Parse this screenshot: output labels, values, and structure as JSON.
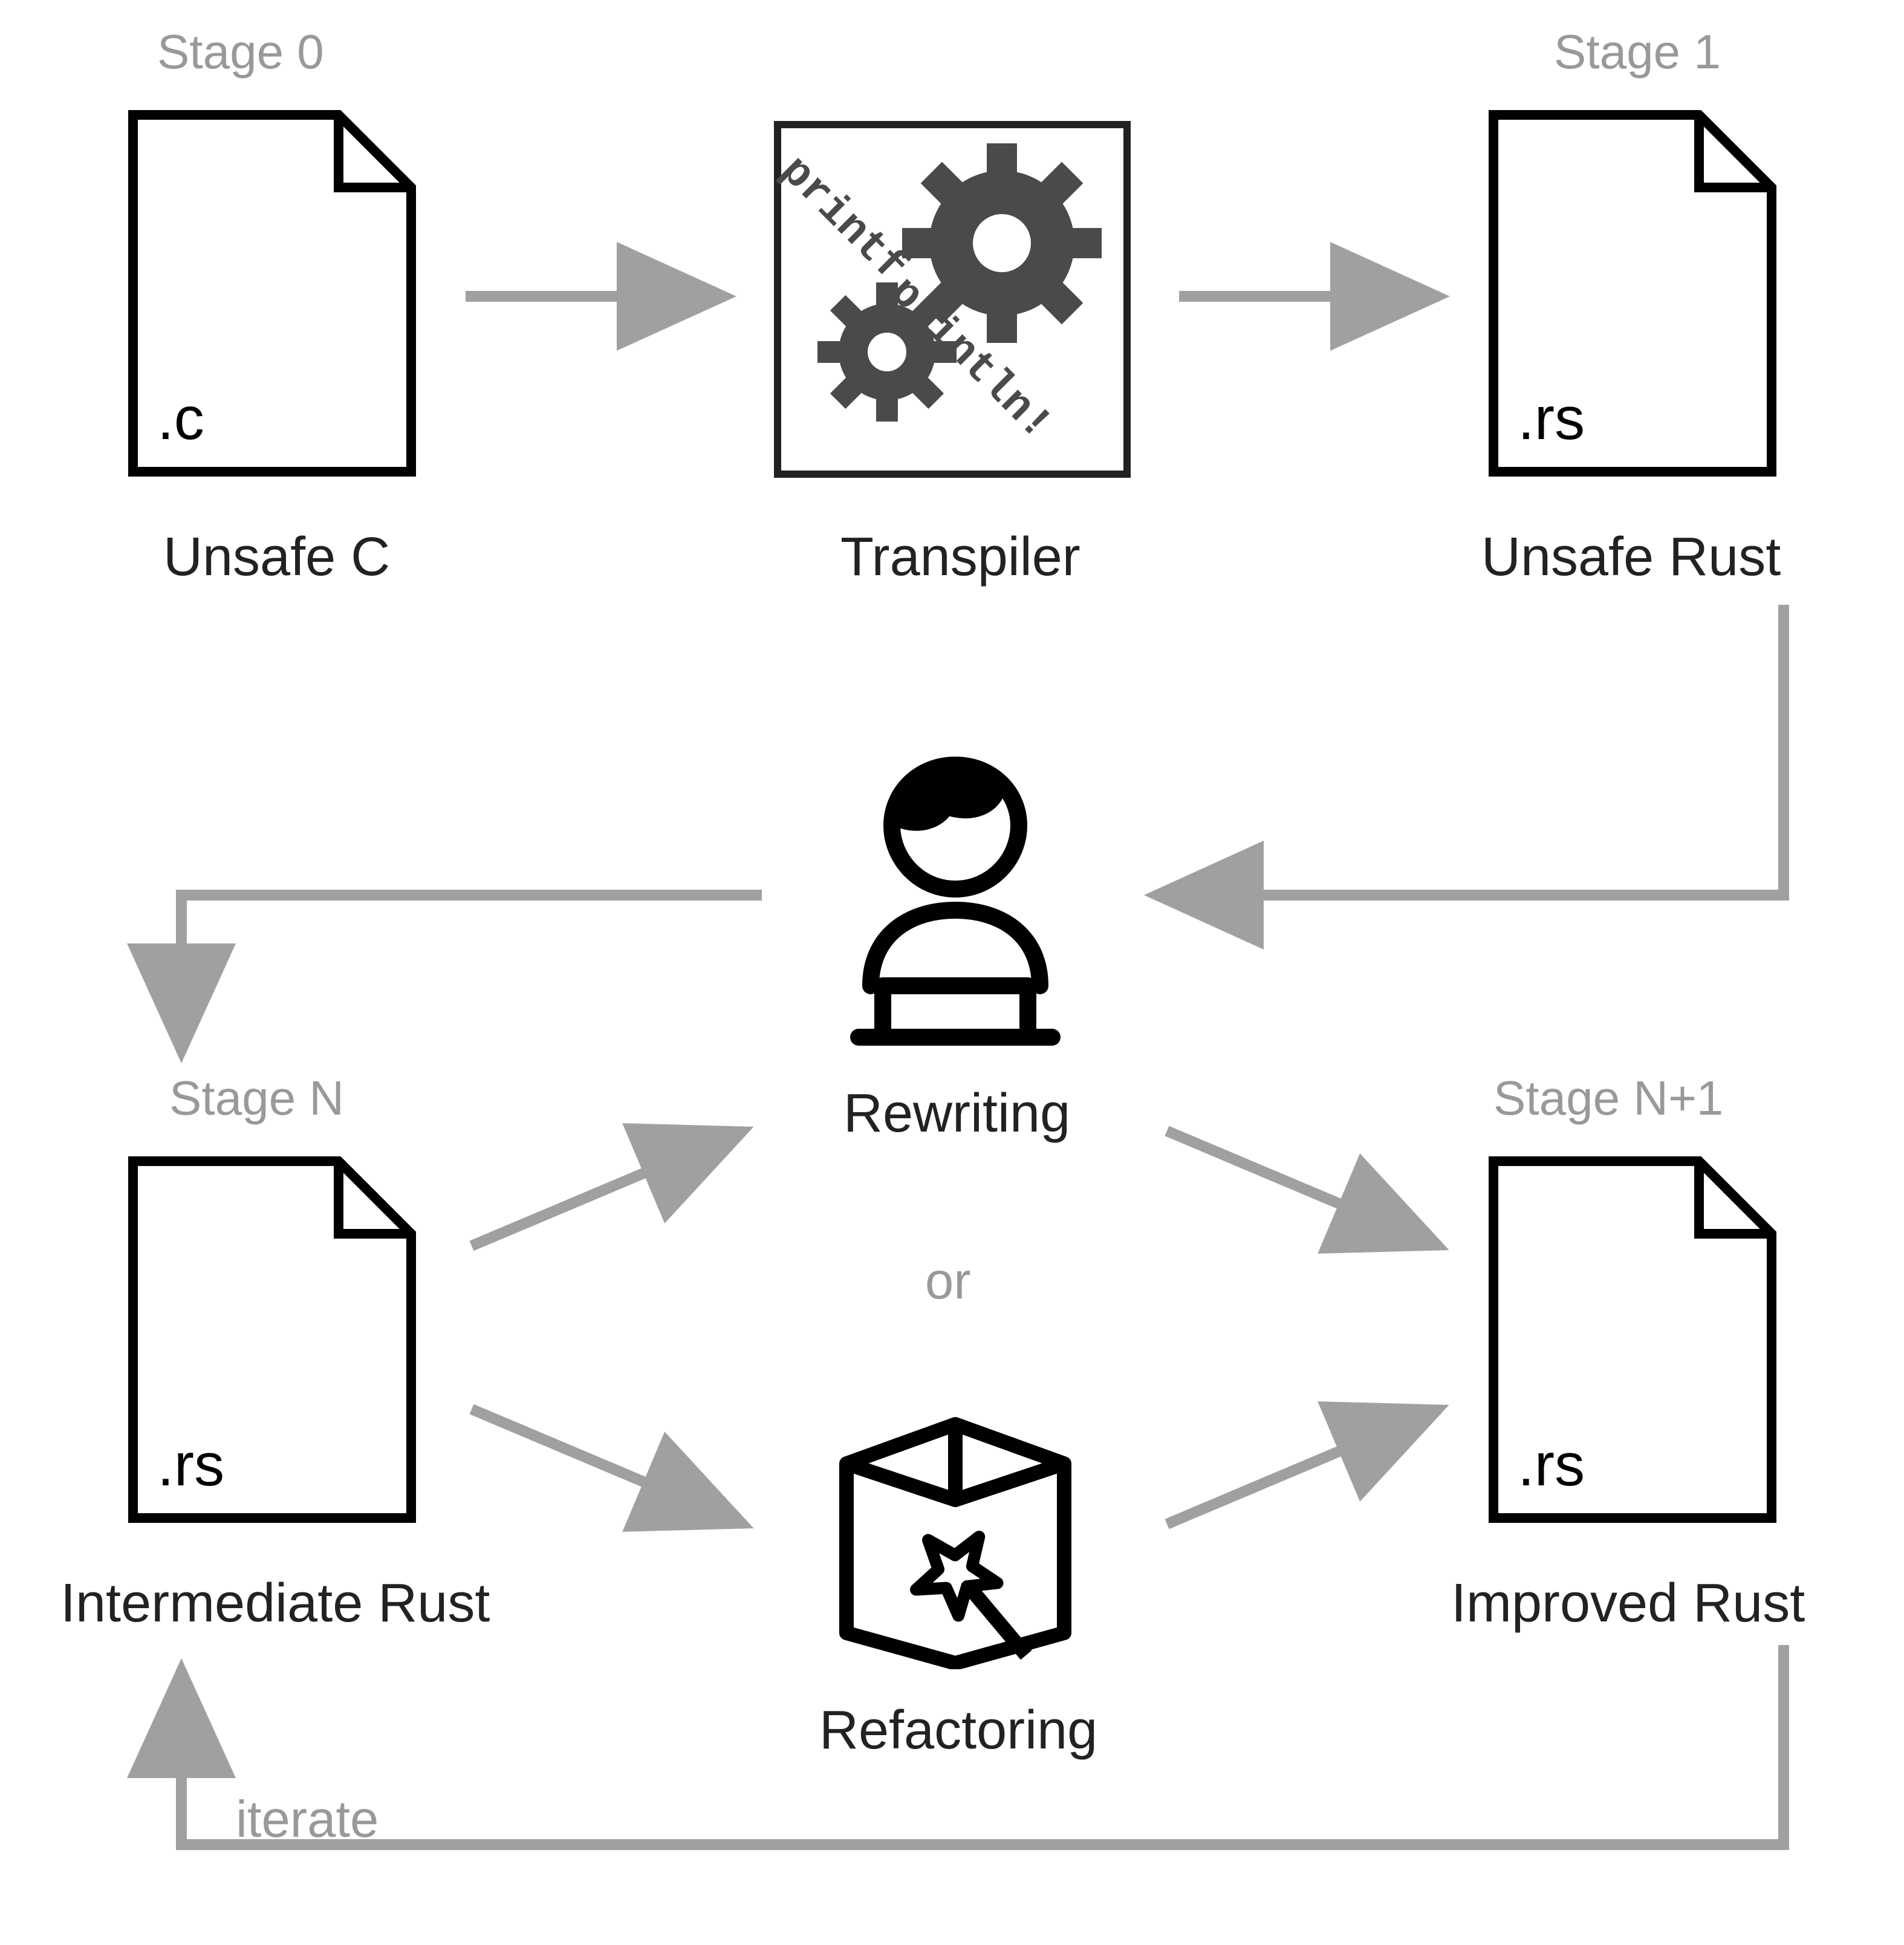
{
  "stages": {
    "s0": "Stage 0",
    "s1": "Stage 1",
    "sn": "Stage N",
    "sn1": "Stage N+1"
  },
  "labels": {
    "unsafe_c": "Unsafe C",
    "transpiler": "Transpiler",
    "unsafe_rust": "Unsafe Rust",
    "rewriting": "Rewriting",
    "or": "or",
    "refactoring": "Refactoring",
    "intermediate_rust": "Intermediate Rust",
    "improved_rust": "Improved Rust",
    "iterate": "iterate"
  },
  "file_ext": {
    "c": ".c",
    "rs": ".rs"
  },
  "transpiler_text": {
    "printf": "printf",
    "println": "println!"
  },
  "chart_data": {
    "type": "diagram",
    "nodes": [
      {
        "id": "unsafe_c",
        "label": "Unsafe C",
        "stage": "Stage 0",
        "kind": "file",
        "ext": ".c"
      },
      {
        "id": "transpiler",
        "label": "Transpiler",
        "kind": "process"
      },
      {
        "id": "unsafe_rust",
        "label": "Unsafe Rust",
        "stage": "Stage 1",
        "kind": "file",
        "ext": ".rs"
      },
      {
        "id": "rewriting",
        "label": "Rewriting",
        "kind": "person"
      },
      {
        "id": "refactoring",
        "label": "Refactoring",
        "kind": "tool"
      },
      {
        "id": "intermediate_rust",
        "label": "Intermediate Rust",
        "stage": "Stage N",
        "kind": "file",
        "ext": ".rs"
      },
      {
        "id": "improved_rust",
        "label": "Improved Rust",
        "stage": "Stage N+1",
        "kind": "file",
        "ext": ".rs"
      }
    ],
    "edges": [
      {
        "from": "unsafe_c",
        "to": "transpiler"
      },
      {
        "from": "transpiler",
        "to": "unsafe_rust"
      },
      {
        "from": "unsafe_rust",
        "to": "rewriting"
      },
      {
        "from": "rewriting",
        "to": "intermediate_rust"
      },
      {
        "from": "intermediate_rust",
        "to": "rewriting"
      },
      {
        "from": "intermediate_rust",
        "to": "refactoring"
      },
      {
        "from": "rewriting",
        "to": "improved_rust"
      },
      {
        "from": "refactoring",
        "to": "improved_rust"
      },
      {
        "from": "improved_rust",
        "to": "intermediate_rust",
        "label": "iterate"
      }
    ],
    "alternative": {
      "between": [
        "rewriting",
        "refactoring"
      ],
      "label": "or"
    }
  }
}
